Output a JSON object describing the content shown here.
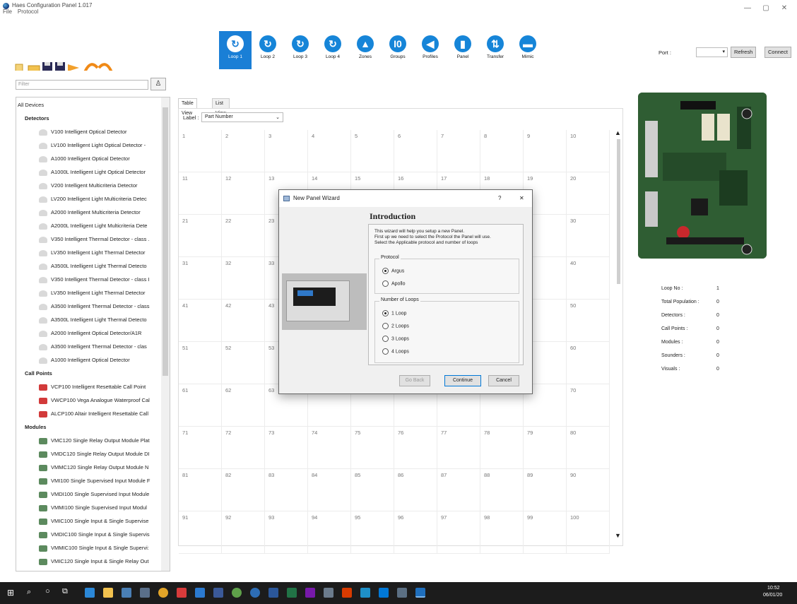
{
  "app": {
    "title": "Haes Configuration Panel 1.017"
  },
  "menu": [
    "File",
    "Protocol"
  ],
  "loop_buttons": [
    {
      "label": "Loop 1",
      "glyph": "↻",
      "active": true
    },
    {
      "label": "Loop 2",
      "glyph": "↻"
    },
    {
      "label": "Loop 3",
      "glyph": "↻"
    },
    {
      "label": "Loop 4",
      "glyph": "↻"
    },
    {
      "label": "Zones",
      "glyph": "▲"
    },
    {
      "label": "Groups",
      "glyph": "I0"
    },
    {
      "label": "Profiles",
      "glyph": "◀"
    },
    {
      "label": "Panel",
      "glyph": "▮"
    },
    {
      "label": "Transfer",
      "glyph": "⇅"
    },
    {
      "label": "Mimic",
      "glyph": "▬"
    }
  ],
  "port": {
    "label": "Port :",
    "refresh": "Refresh",
    "connect": "Connect"
  },
  "filter": {
    "placeholder": "Filter"
  },
  "tree": {
    "root": "All Devices",
    "detectors_label": "Detectors",
    "detectors": [
      "V100 Intelligent Optical Detector",
      "LV100 Intelligent Light Optical Detector -",
      "A1000 Intelligent Optical Detector",
      "A1000L Intelligent Light Optical Detector",
      "V200 Intelligent Multicriteria Detector",
      "LV200 Intelligent Light Multicriteria Detec",
      "A2000 Intelligent Multicriteria  Detector",
      "A2000L Intelligent Light Multicriteria Dete",
      "V350 Intelligent Thermal Detector - class .",
      "LV350 Intelligent Light Thermal Detector",
      "A3500L Intelligent Light Thermal Detecto",
      "V350 Intelligent Thermal Detector - class I",
      "LV350 Intelligent Light Thermal Detector",
      "A3500 Intelligent Thermal Detector - class",
      "A3500L Intelligent Light Thermal Detecto",
      "A2000 Intelligent Optical Detector/A1R",
      "A3500 Intelligent Thermal Detector  - clas",
      "A1000 Intelligent Optical Detector"
    ],
    "callpoints_label": "Call Points",
    "callpoints": [
      "VCP100 Intelligent Resettable Call Point",
      "VWCP100 Vega Analogue Waterproof Cal",
      "ALCP100 Altair Intelligent Resettable Call"
    ],
    "modules_label": "Modules",
    "modules": [
      "VMC120 Single Relay Output Module Plat",
      "VMDC120 Single Relay Output Module DI",
      "VMMC120 Single Relay Output Module N",
      "VMI100 Single Supervised Input Module F",
      "VMDI100 Single Supervised Input Module",
      "VMMI100 Single Supervised Input Modul",
      "VMIC100 Single Input & Single Supervise",
      "VMDIC100 Single Input & Single Supervis",
      "VMMIC100 Single Input & Single Supervi:",
      "VMIC120 Single Input & Single Relay Out"
    ]
  },
  "tabs": {
    "table": "Table View",
    "list": "List View"
  },
  "label_select": {
    "label": "Label :",
    "value": "Part Number"
  },
  "grid": {
    "cells": [
      "1",
      "2",
      "3",
      "4",
      "5",
      "6",
      "7",
      "8",
      "9",
      "10",
      "11",
      "12",
      "13",
      "14",
      "15",
      "16",
      "17",
      "18",
      "19",
      "20",
      "21",
      "22",
      "23",
      "",
      "",
      "",
      "",
      "",
      "",
      "30",
      "31",
      "32",
      "33",
      "",
      "",
      "",
      "",
      "",
      "",
      "40",
      "41",
      "42",
      "43",
      "",
      "",
      "",
      "",
      "",
      "",
      "50",
      "51",
      "52",
      "53",
      "",
      "",
      "",
      "",
      "",
      "",
      "60",
      "61",
      "62",
      "63",
      "",
      "",
      "",
      "",
      "",
      "",
      "70",
      "71",
      "72",
      "73",
      "74",
      "75",
      "76",
      "77",
      "78",
      "79",
      "80",
      "81",
      "82",
      "83",
      "84",
      "85",
      "86",
      "87",
      "88",
      "89",
      "90",
      "91",
      "92",
      "93",
      "94",
      "95",
      "96",
      "97",
      "98",
      "99",
      "100"
    ]
  },
  "info": {
    "rows": [
      {
        "k": "Loop No :",
        "v": "1"
      },
      {
        "k": "Total Population :",
        "v": "0"
      },
      {
        "k": "Detectors :",
        "v": "0"
      },
      {
        "k": "Call Points :",
        "v": "0"
      },
      {
        "k": "Modules :",
        "v": "0"
      },
      {
        "k": "Sounders :",
        "v": "0"
      },
      {
        "k": "Visuals :",
        "v": "0"
      }
    ]
  },
  "dialog": {
    "title": "New Panel Wizard",
    "help": "?",
    "close": "✕",
    "heading": "Introduction",
    "text": "This wizard will help you setup a new Panel.\nFirst up we need to select the Protocol the Panel will use.\nSelect the Applicable protocol and number of loops",
    "protocol_label": "Protocol",
    "protocols": [
      "Argus",
      "Apollo"
    ],
    "loops_label": "Number of Loops",
    "loops": [
      "1 Loop",
      "2 Loops",
      "3 Loops",
      "4 Loops"
    ],
    "go_back": "Go Back",
    "continue": "Continue",
    "cancel": "Cancel"
  },
  "taskbar": {
    "time": "10:52",
    "date": "06/01/20"
  }
}
